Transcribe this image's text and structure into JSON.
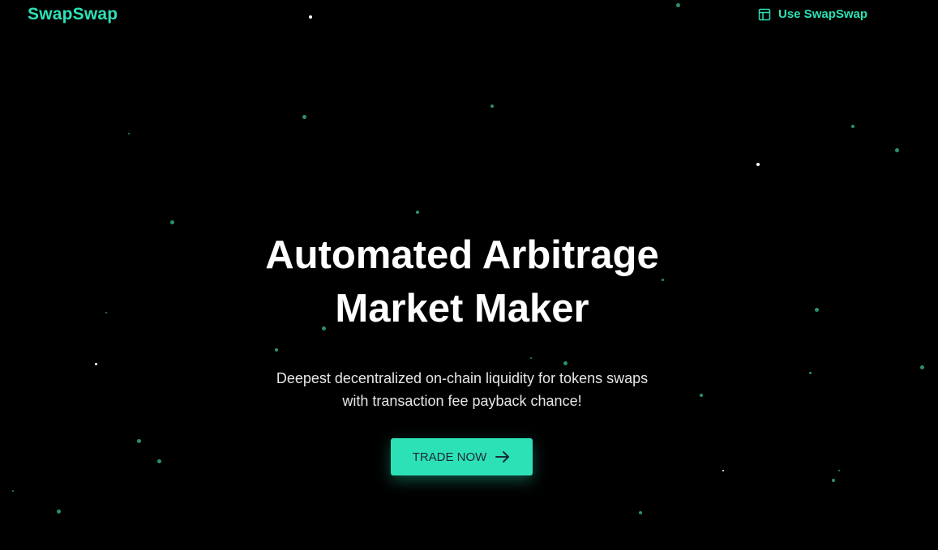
{
  "brand": {
    "name": "SwapSwap",
    "accent_color": "#2de1b6"
  },
  "nav": {
    "use_app_label": "Use SwapSwap",
    "use_app_icon": "layout-icon"
  },
  "hero": {
    "title_line1": "Automated Arbitrage",
    "title_line2": "Market Maker",
    "subtitle_line1": "Deepest decentralized on-chain liquidity for tokens swaps",
    "subtitle_line2": "with transaction fee payback chance!",
    "cta_label": "TRADE NOW",
    "cta_icon": "arrow-right-icon"
  },
  "colors": {
    "background": "#000000",
    "title": "#ffffff",
    "subtitle": "#e6e6e6",
    "cta_text": "#1b2b35",
    "star_green": "#2b8f74",
    "star_white": "#ffffff"
  }
}
